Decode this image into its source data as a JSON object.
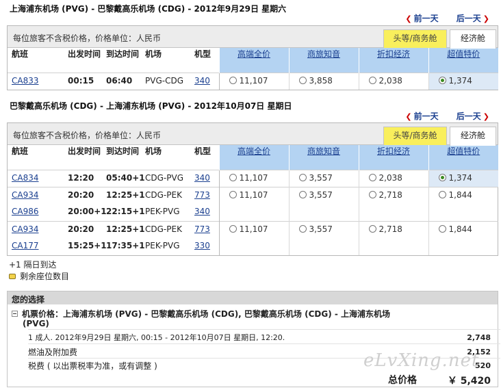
{
  "outbound": {
    "title": "上海浦东机场 (PVG) - 巴黎戴高乐机场 (CDG) - 2012年9月29日  星期六",
    "prev_day": "前一天",
    "next_day": "后一天",
    "note": "每位旅客不含税价格，价格单位：人民币",
    "tab_first": "头等/商务舱",
    "tab_economy": "经济舱",
    "headers": [
      "航班",
      "出发时间",
      "到达时间",
      "机场",
      "机型"
    ],
    "fare_headers": [
      "高端全价",
      "商旅知音",
      "折扣经济",
      "超值特价"
    ],
    "rows": [
      {
        "flight": "CA833",
        "dep": "00:15",
        "arr": "06:40",
        "airport": "PVG-CDG",
        "plane": "340",
        "fares": [
          "11,107",
          "3,858",
          "2,038",
          "1,374"
        ],
        "selected": 3
      }
    ]
  },
  "inbound": {
    "title": "巴黎戴高乐机场 (CDG) - 上海浦东机场 (PVG) - 2012年10月07日  星期日",
    "prev_day": "前一天",
    "next_day": "后一天",
    "note": "每位旅客不含税价格，价格单位：人民币",
    "tab_first": "头等/商务舱",
    "tab_economy": "经济舱",
    "headers": [
      "航班",
      "出发时间",
      "到达时间",
      "机场",
      "机型"
    ],
    "fare_headers": [
      "高端全价",
      "商旅知音",
      "折扣经济",
      "超值特价"
    ],
    "groups": [
      {
        "segments": [
          {
            "flight": "CA834",
            "dep": "12:20",
            "arr": "05:40+1",
            "airport": "CDG-PVG",
            "plane": "340"
          }
        ],
        "fares": [
          "11,107",
          "3,557",
          "2,038",
          "1,374"
        ],
        "selected": 3
      },
      {
        "segments": [
          {
            "flight": "CA934",
            "dep": "20:20",
            "arr": "12:25+1",
            "airport": "CDG-PEK",
            "plane": "773"
          },
          {
            "flight": "CA986",
            "dep": "20:00+1",
            "arr": "22:15+1",
            "airport": "PEK-PVG",
            "plane": "340"
          }
        ],
        "fares": [
          "11,107",
          "3,557",
          "2,718",
          "1,844"
        ],
        "selected": -1
      },
      {
        "segments": [
          {
            "flight": "CA934",
            "dep": "20:20",
            "arr": "12:25+1",
            "airport": "CDG-PEK",
            "plane": "773"
          },
          {
            "flight": "CA177",
            "dep": "15:25+1",
            "arr": "17:35+1",
            "airport": "PEK-PVG",
            "plane": "330"
          }
        ],
        "fares": [
          "11,107",
          "3,557",
          "2,718",
          "1,844"
        ],
        "selected": -1
      }
    ]
  },
  "legend": {
    "next_day": "+1  隔日到达",
    "seats": "剩余座位数目"
  },
  "choice": {
    "heading": "您的选择",
    "ticket_label": "机票价格：上海浦东机场 (PVG) - 巴黎戴高乐机场 (CDG), 巴黎戴高乐机场 (CDG) - 上海浦东机场",
    "ticket_label2": "(PVG)",
    "passenger_line": "1 成人. 2012年9月29日  星期六, 00:15 - 2012年10月07日  星期日, 12:20.",
    "passenger_amount": "2,748",
    "fuel_label": "燃油及附加费",
    "fuel_amount": "2,152",
    "tax_label": "税费 ( 以出票税率为准，或有调整 )",
    "tax_amount": "520",
    "total_label": "总价格",
    "total_amount": "￥ 5,420"
  },
  "watermark": "eLvXing.net"
}
